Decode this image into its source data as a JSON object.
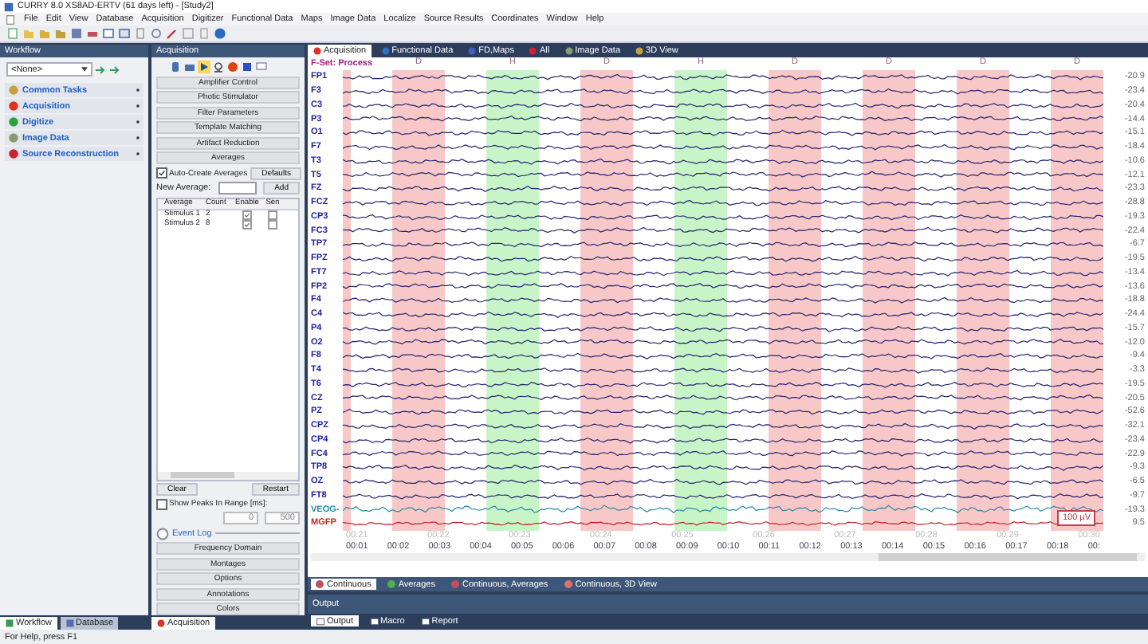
{
  "window": {
    "title": "CURRY 8.0 XS8AD-ERTV (61 days left) - [Study2]"
  },
  "menu": [
    "File",
    "Edit",
    "View",
    "Database",
    "Acquisition",
    "Digitizer",
    "Functional Data",
    "Maps",
    "Image Data",
    "Localize",
    "Source Results",
    "Coordinates",
    "Window",
    "Help"
  ],
  "workflow": {
    "title": "Workflow",
    "dropdown": "<None>",
    "items": [
      {
        "label": "Common Tasks",
        "kind": "tasks"
      },
      {
        "label": "Acquisition",
        "kind": "record"
      },
      {
        "label": "Digitize",
        "kind": "pin"
      },
      {
        "label": "Image Data",
        "kind": "head"
      },
      {
        "label": "Source Reconstruction",
        "kind": "source"
      }
    ],
    "tabs": [
      {
        "label": "Workflow",
        "selected": true
      },
      {
        "label": "Database",
        "selected": false
      }
    ]
  },
  "acquisition": {
    "title": "Acquisition",
    "top_buttons": [
      "Amplifier Control",
      "Photic Stimulator",
      "Filter Parameters",
      "Template Matching",
      "Artifact Reduction",
      "Averages"
    ],
    "auto_create": {
      "label": "Auto-Create Averages",
      "checked": true
    },
    "defaults_button": "Defaults",
    "new_average_label": "New Average:",
    "add_button": "Add",
    "table": {
      "columns": [
        "Average",
        "Count",
        "Enable",
        "Sen"
      ],
      "rows": [
        {
          "average": "Stimulus 1",
          "count": "2",
          "enable": true,
          "sen": false
        },
        {
          "average": "Stimulus 2",
          "count": "8",
          "enable": true,
          "sen": false
        }
      ]
    },
    "clear_button": "Clear",
    "restart_button": "Restart",
    "show_peaks": {
      "label": "Show Peaks In Range [ms]:",
      "checked": false
    },
    "range_from": "0",
    "range_to": "500",
    "event_log": "Event Log",
    "bottom_buttons": [
      "Frequency Domain",
      "Montages",
      "Options",
      "Annotations",
      "Colors"
    ],
    "tab": {
      "label": "Acquisition",
      "selected": true
    }
  },
  "view_tabs": [
    {
      "label": "Acquisition",
      "selected": true,
      "kind": "record"
    },
    {
      "label": "Functional Data",
      "selected": false,
      "kind": "globe"
    },
    {
      "label": "FD,Maps",
      "selected": false,
      "kind": "maps"
    },
    {
      "label": "All",
      "selected": false,
      "kind": "source"
    },
    {
      "label": "Image Data",
      "selected": false,
      "kind": "head"
    },
    {
      "label": "3D View",
      "selected": false,
      "kind": "tasks"
    }
  ],
  "plot": {
    "set_label": "F-Set: Process",
    "epochs": [
      {
        "color": "#f8c8c8"
      },
      {
        "marker": "D",
        "color": "#f8c8c8"
      },
      {
        "marker": "H",
        "color": "#c8f5c8"
      },
      {
        "marker": "D",
        "color": "#f8c8c8"
      },
      {
        "marker": "H",
        "color": "#c8f5c8"
      },
      {
        "marker": "D",
        "color": "#f8c8c8"
      },
      {
        "marker": "D",
        "color": "#f8c8c8"
      },
      {
        "marker": "D",
        "color": "#f8c8c8"
      },
      {
        "marker": "D",
        "color": "#f8c8c8"
      }
    ],
    "channels": [
      {
        "name": "FP1",
        "value": "-20.9",
        "kind": "eeg"
      },
      {
        "name": "F3",
        "value": "-23.4",
        "kind": "eeg"
      },
      {
        "name": "C3",
        "value": "-20.4",
        "kind": "eeg"
      },
      {
        "name": "P3",
        "value": "-14.4",
        "kind": "eeg"
      },
      {
        "name": "O1",
        "value": "-15.1",
        "kind": "eeg"
      },
      {
        "name": "F7",
        "value": "-18.4",
        "kind": "eeg"
      },
      {
        "name": "T3",
        "value": "-10.6",
        "kind": "eeg"
      },
      {
        "name": "T5",
        "value": "-12.1",
        "kind": "eeg"
      },
      {
        "name": "FZ",
        "value": "-23.3",
        "kind": "eeg"
      },
      {
        "name": "FCZ",
        "value": "-28.8",
        "kind": "eeg"
      },
      {
        "name": "CP3",
        "value": "-19.3",
        "kind": "eeg"
      },
      {
        "name": "FC3",
        "value": "-22.4",
        "kind": "eeg"
      },
      {
        "name": "TP7",
        "value": "-6.7",
        "kind": "eeg"
      },
      {
        "name": "FPZ",
        "value": "-19.5",
        "kind": "eeg"
      },
      {
        "name": "FT7",
        "value": "-13.4",
        "kind": "eeg"
      },
      {
        "name": "FP2",
        "value": "-13.6",
        "kind": "eeg"
      },
      {
        "name": "F4",
        "value": "-18.8",
        "kind": "eeg"
      },
      {
        "name": "C4",
        "value": "-24.4",
        "kind": "eeg"
      },
      {
        "name": "P4",
        "value": "-15.7",
        "kind": "eeg"
      },
      {
        "name": "O2",
        "value": "-12.0",
        "kind": "eeg"
      },
      {
        "name": "F8",
        "value": "-9.4",
        "kind": "eeg"
      },
      {
        "name": "T4",
        "value": "-3.3",
        "kind": "eeg"
      },
      {
        "name": "T6",
        "value": "-19.5",
        "kind": "eeg"
      },
      {
        "name": "CZ",
        "value": "-20.5",
        "kind": "eeg"
      },
      {
        "name": "PZ",
        "value": "-52.6",
        "kind": "eeg"
      },
      {
        "name": "CPZ",
        "value": "-32.1",
        "kind": "eeg"
      },
      {
        "name": "CP4",
        "value": "-23.4",
        "kind": "eeg"
      },
      {
        "name": "FC4",
        "value": "-22.9",
        "kind": "eeg"
      },
      {
        "name": "TP8",
        "value": "-9.3",
        "kind": "eeg"
      },
      {
        "name": "OZ",
        "value": "-6.5",
        "kind": "eeg"
      },
      {
        "name": "FT8",
        "value": "-9.7",
        "kind": "eeg"
      },
      {
        "name": "VEOG-",
        "value": "-19.3",
        "kind": "eog"
      },
      {
        "name": "MGFP",
        "value": "9.5",
        "kind": "gfp"
      }
    ],
    "scale": "100 µV",
    "ticks_upper": [
      "00:21",
      "00:22",
      "00:23",
      "00:24",
      "00:25",
      "00:26",
      "00:27",
      "00:28",
      "00:29",
      "00:30"
    ],
    "ticks_lower": [
      "00:01",
      "00:02",
      "00:03",
      "00:04",
      "00:05",
      "00:06",
      "00:07",
      "00:08",
      "00:09",
      "00:10",
      "00:11",
      "00:12",
      "00:13",
      "00:14",
      "00:15",
      "00:16",
      "00:17",
      "00:18",
      "00:"
    ]
  },
  "legend_tabs": [
    {
      "label": "Continuous",
      "selected": true,
      "color": "#c05060"
    },
    {
      "label": "Averages",
      "selected": false,
      "color": "#50b050"
    },
    {
      "label": "Continuous, Averages",
      "selected": false,
      "color": "#c05060"
    },
    {
      "label": "Continuous, 3D View",
      "selected": false,
      "color": "#e07070"
    }
  ],
  "output": {
    "title": "Output",
    "tabs": [
      {
        "label": "Output",
        "selected": true
      },
      {
        "label": "Macro",
        "selected": false
      },
      {
        "label": "Report",
        "selected": false
      }
    ]
  },
  "status_bar": "For Help, press F1"
}
